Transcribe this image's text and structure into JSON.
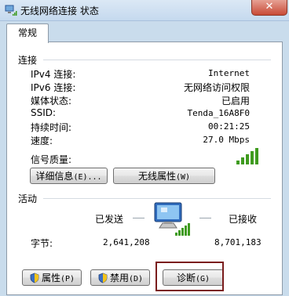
{
  "window": {
    "title": "无线网络连接 状态",
    "close_label": "✕"
  },
  "tab": {
    "label": "常规"
  },
  "connection": {
    "title": "连接",
    "rows": [
      {
        "label": "IPv4 连接:",
        "value": "Internet"
      },
      {
        "label": "IPv6 连接:",
        "value": "无网络访问权限"
      },
      {
        "label": "媒体状态:",
        "value": "已启用"
      },
      {
        "label": "SSID:",
        "value": "Tenda_16A8F0"
      },
      {
        "label": "持续时间:",
        "value": "00:21:25"
      },
      {
        "label": "速度:",
        "value": "27.0 Mbps"
      }
    ],
    "signal_label": "信号质量:",
    "signal_bars": 5,
    "signal_max": 5,
    "details_button": {
      "label": "详细信息",
      "mnemonic": "(E)..."
    },
    "wireless_button": {
      "label": "无线属性",
      "mnemonic": "(W)"
    }
  },
  "activity": {
    "title": "活动",
    "sent_label": "已发送",
    "received_label": "已接收",
    "bytes_label": "字节:",
    "bytes_sent": "2,641,208",
    "bytes_received": "8,701,183"
  },
  "buttons": {
    "properties": {
      "label": "属性",
      "mnemonic": "(P)"
    },
    "disable": {
      "label": "禁用",
      "mnemonic": "(D)"
    },
    "diagnose": {
      "label": "诊断",
      "mnemonic": "(G)"
    }
  },
  "colors": {
    "signal_green": "#3f9b1f",
    "highlight_border": "#7a1c1c",
    "close_red": "#c84a36"
  }
}
